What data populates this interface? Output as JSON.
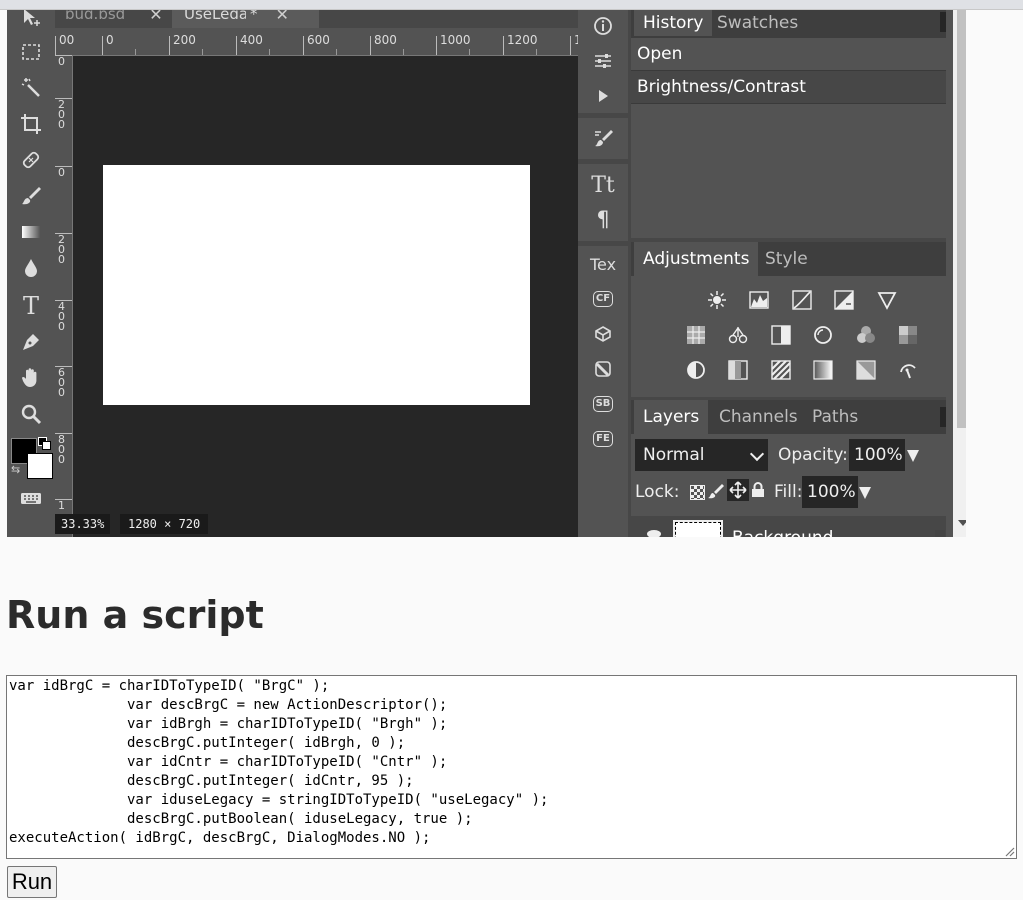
{
  "tabs": [
    {
      "name": "pug.psd",
      "close": "✕"
    },
    {
      "name": "UseLegacy",
      "modified": "*",
      "close": "✕"
    }
  ],
  "ruler_top_labels": [
    "00",
    "0",
    "200",
    "400",
    "600",
    "800",
    "1000",
    "1200",
    "1"
  ],
  "ruler_left_labels": [
    "0",
    "200",
    "0",
    "200",
    "400",
    "600",
    "800",
    "1"
  ],
  "status": {
    "zoom": "33.33%",
    "size": "1280 × 720"
  },
  "strip": {
    "text_label": "Tex",
    "badges": [
      "CF",
      "SB",
      "FE"
    ]
  },
  "history_panel": {
    "tabs": [
      "History",
      "Swatches"
    ],
    "items": [
      "Open",
      "Brightness/Contrast"
    ]
  },
  "adjustments_panel": {
    "tabs": [
      "Adjustments",
      "Style"
    ]
  },
  "layers_panel": {
    "tabs": [
      "Layers",
      "Channels",
      "Paths"
    ],
    "blend_mode": "Normal",
    "opacity_label": "Opacity:",
    "opacity": "100%",
    "lock_label": "Lock:",
    "fill_label": "Fill:",
    "fill": "100%",
    "layer_name": "Background"
  },
  "page": {
    "heading": "Run a script",
    "script": "var idBrgC = charIDToTypeID( \"BrgC\" );\n              var descBrgC = new ActionDescriptor();\n              var idBrgh = charIDToTypeID( \"Brgh\" );\n              descBrgC.putInteger( idBrgh, 0 );\n              var idCntr = charIDToTypeID( \"Cntr\" );\n              descBrgC.putInteger( idCntr, 95 );\n              var iduseLegacy = stringIDToTypeID( \"useLegacy\" );\n              descBrgC.putBoolean( iduseLegacy, true );\nexecuteAction( idBrgC, descBrgC, DialogModes.NO );",
    "run_label": "Run"
  }
}
